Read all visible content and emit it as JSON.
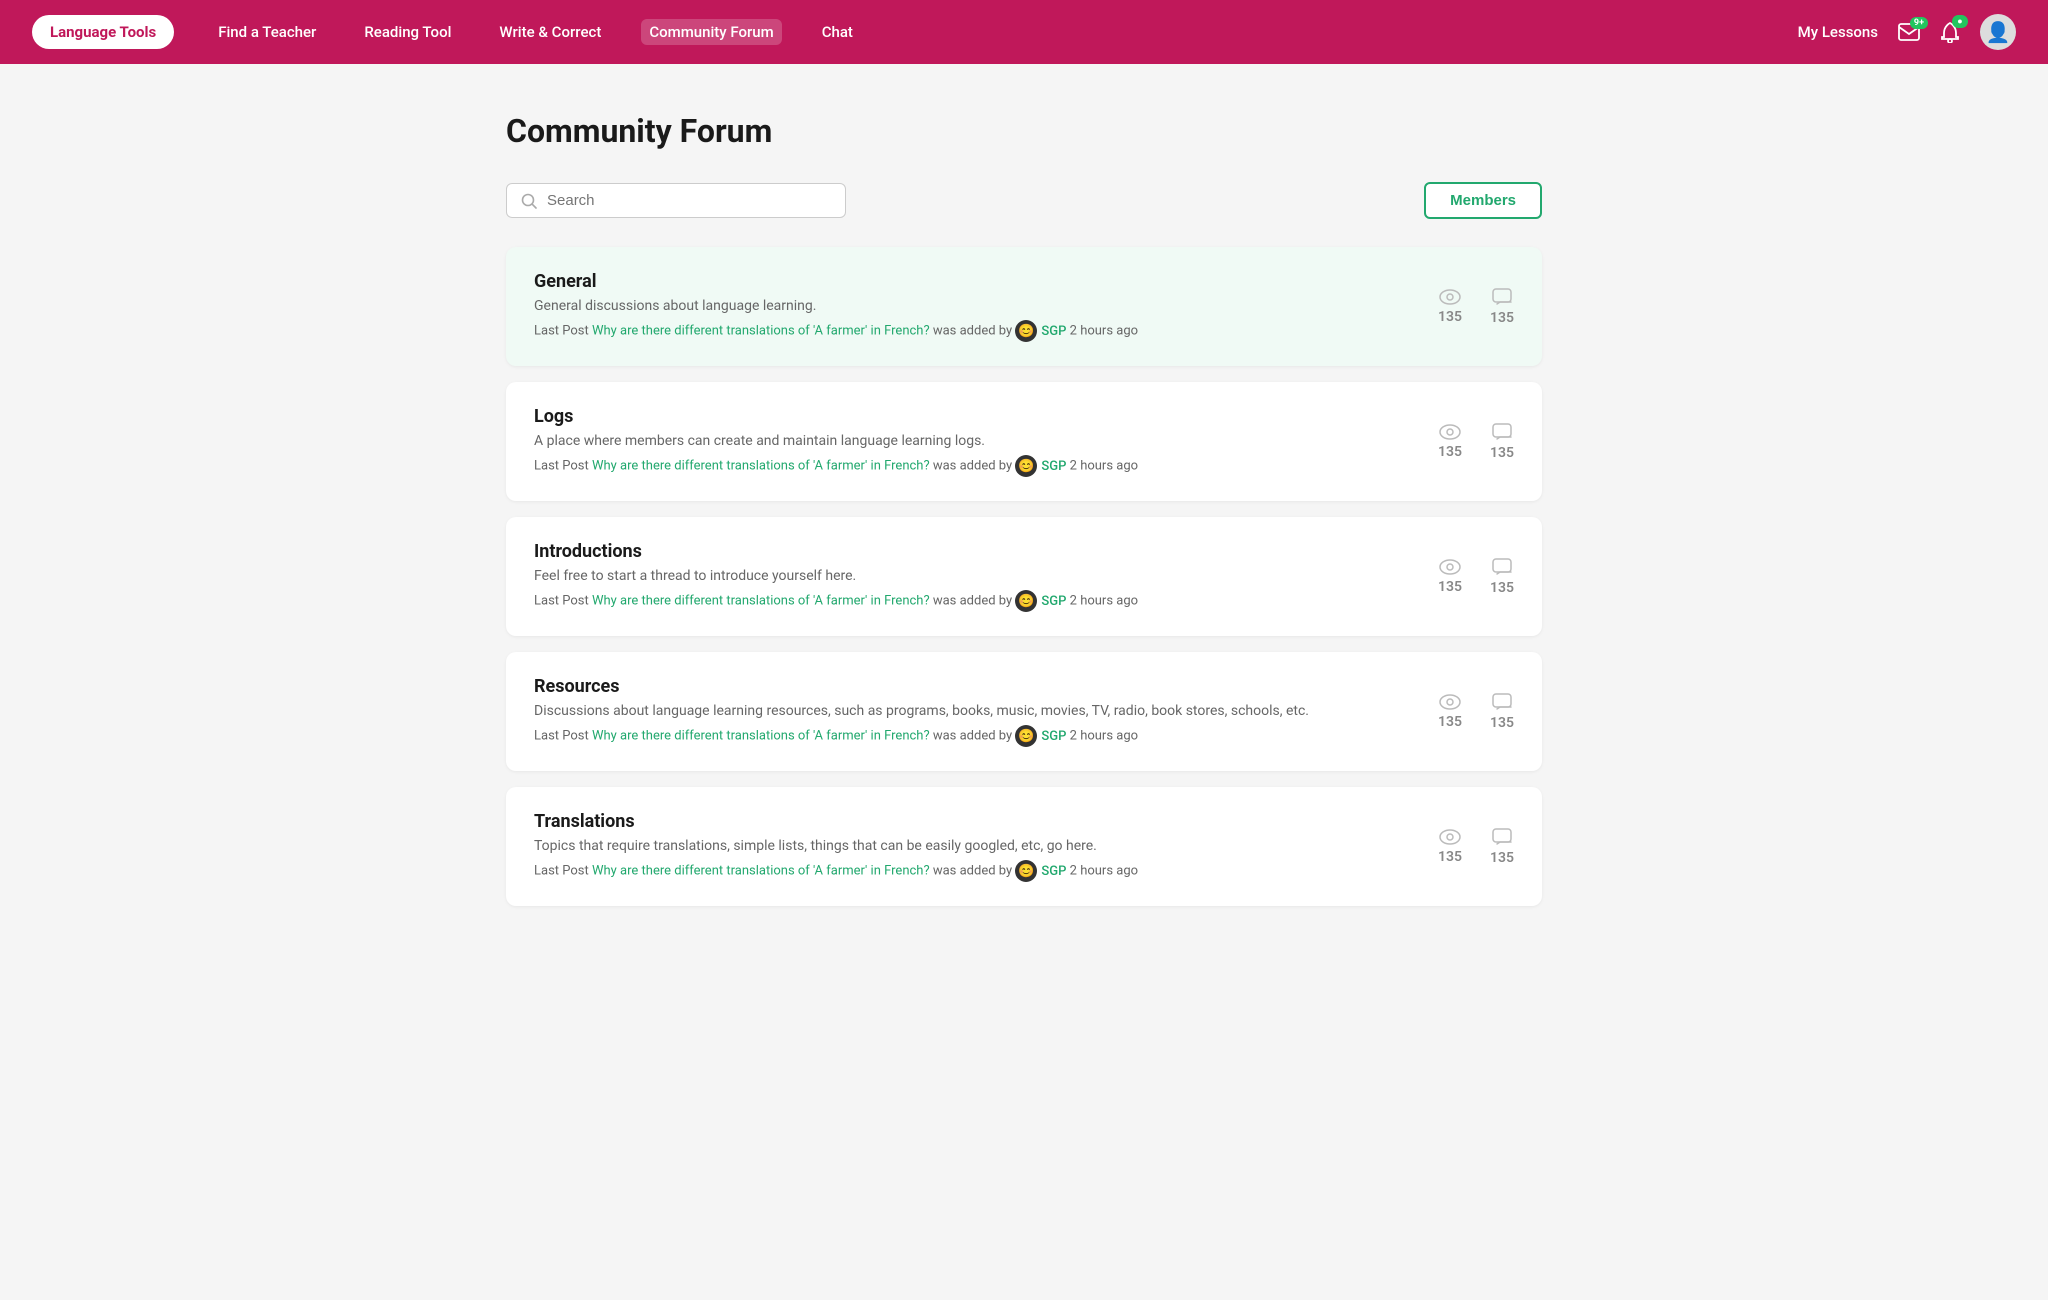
{
  "nav": {
    "logo": "Language Tools",
    "links": [
      {
        "label": "Find a Teacher",
        "active": false
      },
      {
        "label": "Reading Tool",
        "active": false
      },
      {
        "label": "Write & Correct",
        "active": false
      },
      {
        "label": "Community Forum",
        "active": true
      },
      {
        "label": "Chat",
        "active": false
      }
    ],
    "my_lessons": "My Lessons",
    "mail_badge": "9+",
    "bell_badge": "●"
  },
  "page": {
    "title": "Community Forum",
    "search_placeholder": "Search",
    "members_btn": "Members"
  },
  "forums": [
    {
      "id": "general",
      "name": "General",
      "description": "General discussions about language learning.",
      "last_post_prefix": "Last Post",
      "last_post_link": "Why are there different translations of 'A farmer' in French?",
      "last_post_suffix": "was added by",
      "last_post_user": "SGP",
      "last_post_time": "2 hours ago",
      "views": 135,
      "comments": 135,
      "highlighted": true
    },
    {
      "id": "logs",
      "name": "Logs",
      "description": "A place where members can create and maintain language learning logs.",
      "last_post_prefix": "Last Post",
      "last_post_link": "Why are there different translations of 'A farmer' in French?",
      "last_post_suffix": "was added by",
      "last_post_user": "SGP",
      "last_post_time": "2 hours ago",
      "views": 135,
      "comments": 135,
      "highlighted": false
    },
    {
      "id": "introductions",
      "name": "Introductions",
      "description": "Feel free to start a thread to introduce yourself here.",
      "last_post_prefix": "Last Post",
      "last_post_link": "Why are there different translations of 'A farmer' in French?",
      "last_post_suffix": "was added by",
      "last_post_user": "SGP",
      "last_post_time": "2 hours ago",
      "views": 135,
      "comments": 135,
      "highlighted": false
    },
    {
      "id": "resources",
      "name": "Resources",
      "description": "Discussions about language learning resources, such as programs, books, music, movies, TV, radio, book stores, schools, etc.",
      "last_post_prefix": "Last Post",
      "last_post_link": "Why are there different translations of 'A farmer' in French?",
      "last_post_suffix": "was added by",
      "last_post_user": "SGP",
      "last_post_time": "2 hours ago",
      "views": 135,
      "comments": 135,
      "highlighted": false
    },
    {
      "id": "translations",
      "name": "Translations",
      "description": "Topics that require translations, simple lists, things that can be easily googled, etc, go here.",
      "last_post_prefix": "Last Post",
      "last_post_link": "Why are there different translations of 'A farmer' in French?",
      "last_post_suffix": "was added by",
      "last_post_user": "SGP",
      "last_post_time": "2 hours ago",
      "views": 135,
      "comments": 135,
      "highlighted": false
    }
  ]
}
